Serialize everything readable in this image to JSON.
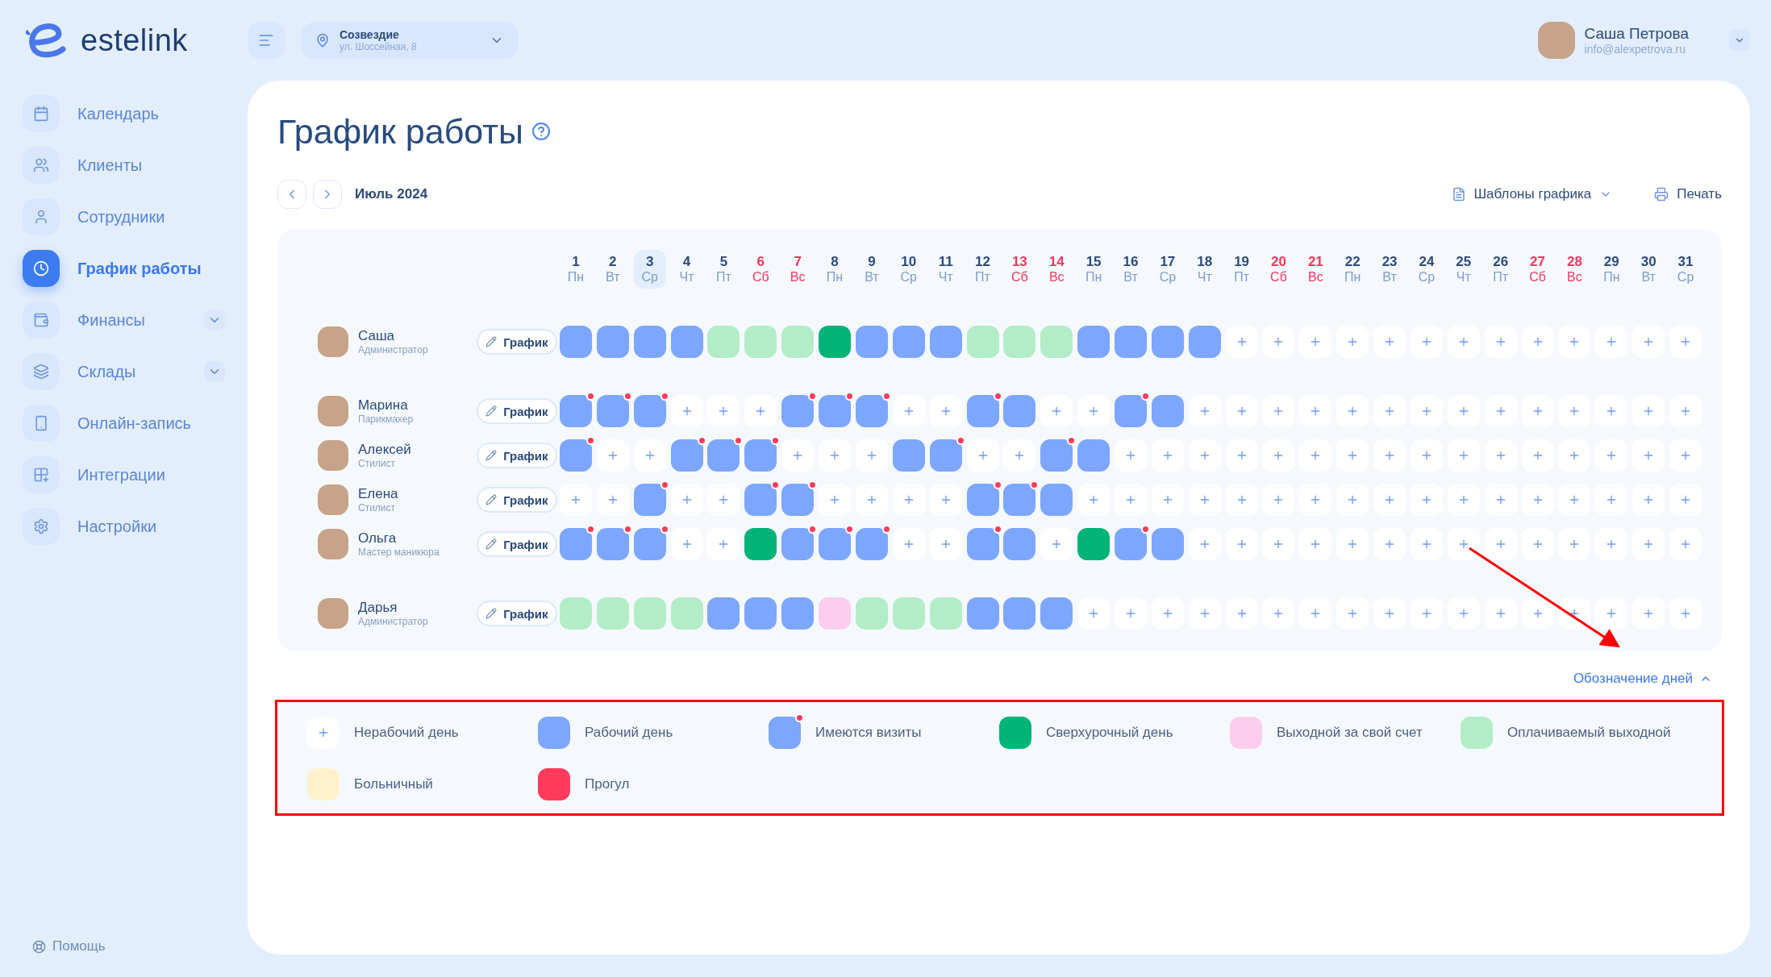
{
  "logo": {
    "text": "estelink"
  },
  "location": {
    "name": "Созвездие",
    "address": "ул. Шоссейная, 8"
  },
  "user": {
    "name": "Саша Петрова",
    "email": "info@alexpetrova.ru"
  },
  "sidebar": {
    "items": [
      {
        "label": "Календарь",
        "selected": false,
        "expandable": false
      },
      {
        "label": "Клиенты",
        "selected": false,
        "expandable": false
      },
      {
        "label": "Сотрудники",
        "selected": false,
        "expandable": false
      },
      {
        "label": "График работы",
        "selected": true,
        "expandable": false
      },
      {
        "label": "Финансы",
        "selected": false,
        "expandable": true
      },
      {
        "label": "Склады",
        "selected": false,
        "expandable": true
      },
      {
        "label": "Онлайн-запись",
        "selected": false,
        "expandable": false
      },
      {
        "label": "Интеграции",
        "selected": false,
        "expandable": false
      },
      {
        "label": "Настройки",
        "selected": false,
        "expandable": false
      }
    ],
    "help": "Помощь"
  },
  "page": {
    "title": "График работы",
    "month": "Июль 2024",
    "templates": "Шаблоны графика",
    "print": "Печать"
  },
  "days": [
    {
      "day": "1",
      "weekday": "Пн",
      "weekend": false,
      "selected": false
    },
    {
      "day": "2",
      "weekday": "Вт",
      "weekend": false,
      "selected": false
    },
    {
      "day": "3",
      "weekday": "Ср",
      "weekend": false,
      "selected": true
    },
    {
      "day": "4",
      "weekday": "Чт",
      "weekend": false,
      "selected": false
    },
    {
      "day": "5",
      "weekday": "Пт",
      "weekend": false,
      "selected": false
    },
    {
      "day": "6",
      "weekday": "Сб",
      "weekend": true,
      "selected": false
    },
    {
      "day": "7",
      "weekday": "Вс",
      "weekend": true,
      "selected": false
    },
    {
      "day": "8",
      "weekday": "Пн",
      "weekend": false,
      "selected": false
    },
    {
      "day": "9",
      "weekday": "Вт",
      "weekend": false,
      "selected": false
    },
    {
      "day": "10",
      "weekday": "Ср",
      "weekend": false,
      "selected": false
    },
    {
      "day": "11",
      "weekday": "Чт",
      "weekend": false,
      "selected": false
    },
    {
      "day": "12",
      "weekday": "Пт",
      "weekend": false,
      "selected": false
    },
    {
      "day": "13",
      "weekday": "Сб",
      "weekend": true,
      "selected": false
    },
    {
      "day": "14",
      "weekday": "Вс",
      "weekend": true,
      "selected": false
    },
    {
      "day": "15",
      "weekday": "Пн",
      "weekend": false,
      "selected": false
    },
    {
      "day": "16",
      "weekday": "Вт",
      "weekend": false,
      "selected": false
    },
    {
      "day": "17",
      "weekday": "Ср",
      "weekend": false,
      "selected": false
    },
    {
      "day": "18",
      "weekday": "Чт",
      "weekend": false,
      "selected": false
    },
    {
      "day": "19",
      "weekday": "Пт",
      "weekend": false,
      "selected": false
    },
    {
      "day": "20",
      "weekday": "Сб",
      "weekend": true,
      "selected": false
    },
    {
      "day": "21",
      "weekday": "Вс",
      "weekend": true,
      "selected": false
    },
    {
      "day": "22",
      "weekday": "Пн",
      "weekend": false,
      "selected": false
    },
    {
      "day": "23",
      "weekday": "Вт",
      "weekend": false,
      "selected": false
    },
    {
      "day": "24",
      "weekday": "Ср",
      "weekend": false,
      "selected": false
    },
    {
      "day": "25",
      "weekday": "Чт",
      "weekend": false,
      "selected": false
    },
    {
      "day": "26",
      "weekday": "Пт",
      "weekend": false,
      "selected": false
    },
    {
      "day": "27",
      "weekday": "Сб",
      "weekend": true,
      "selected": false
    },
    {
      "day": "28",
      "weekday": "Вс",
      "weekend": true,
      "selected": false
    },
    {
      "day": "29",
      "weekday": "Пн",
      "weekend": false,
      "selected": false
    },
    {
      "day": "30",
      "weekday": "Вт",
      "weekend": false,
      "selected": false
    },
    {
      "day": "31",
      "weekday": "Ср",
      "weekend": false,
      "selected": false
    }
  ],
  "groups": [
    {
      "employees": [
        {
          "name": "Саша",
          "role": "Администратор",
          "button": "График",
          "cells": [
            {
              "kind": "work"
            },
            {
              "kind": "work"
            },
            {
              "kind": "work"
            },
            {
              "kind": "work"
            },
            {
              "kind": "paid"
            },
            {
              "kind": "paid"
            },
            {
              "kind": "paid"
            },
            {
              "kind": "overtime"
            },
            {
              "kind": "work"
            },
            {
              "kind": "work"
            },
            {
              "kind": "work"
            },
            {
              "kind": "paid"
            },
            {
              "kind": "paid"
            },
            {
              "kind": "paid"
            },
            {
              "kind": "work"
            },
            {
              "kind": "work"
            },
            {
              "kind": "work"
            },
            {
              "kind": "work"
            },
            {
              "kind": "off"
            },
            {
              "kind": "off"
            },
            {
              "kind": "off"
            },
            {
              "kind": "off"
            },
            {
              "kind": "off"
            },
            {
              "kind": "off"
            },
            {
              "kind": "off"
            },
            {
              "kind": "off"
            },
            {
              "kind": "off"
            },
            {
              "kind": "off"
            },
            {
              "kind": "off"
            },
            {
              "kind": "off"
            },
            {
              "kind": "off"
            }
          ]
        }
      ]
    },
    {
      "employees": [
        {
          "name": "Марина",
          "role": "Парикмахер",
          "button": "График",
          "cells": [
            {
              "kind": "visits"
            },
            {
              "kind": "visits"
            },
            {
              "kind": "visits"
            },
            {
              "kind": "off"
            },
            {
              "kind": "off"
            },
            {
              "kind": "off"
            },
            {
              "kind": "visits"
            },
            {
              "kind": "visits"
            },
            {
              "kind": "visits"
            },
            {
              "kind": "off"
            },
            {
              "kind": "off"
            },
            {
              "kind": "visits"
            },
            {
              "kind": "work"
            },
            {
              "kind": "off"
            },
            {
              "kind": "off"
            },
            {
              "kind": "visits"
            },
            {
              "kind": "work"
            },
            {
              "kind": "off"
            },
            {
              "kind": "off"
            },
            {
              "kind": "off"
            },
            {
              "kind": "off"
            },
            {
              "kind": "off"
            },
            {
              "kind": "off"
            },
            {
              "kind": "off"
            },
            {
              "kind": "off"
            },
            {
              "kind": "off"
            },
            {
              "kind": "off"
            },
            {
              "kind": "off"
            },
            {
              "kind": "off"
            },
            {
              "kind": "off"
            },
            {
              "kind": "off"
            }
          ]
        },
        {
          "name": "Алексей",
          "role": "Стилист",
          "button": "График",
          "cells": [
            {
              "kind": "visits"
            },
            {
              "kind": "off"
            },
            {
              "kind": "off"
            },
            {
              "kind": "visits"
            },
            {
              "kind": "visits"
            },
            {
              "kind": "visits"
            },
            {
              "kind": "off"
            },
            {
              "kind": "off"
            },
            {
              "kind": "off"
            },
            {
              "kind": "work"
            },
            {
              "kind": "visits"
            },
            {
              "kind": "off"
            },
            {
              "kind": "off"
            },
            {
              "kind": "visits"
            },
            {
              "kind": "work"
            },
            {
              "kind": "off"
            },
            {
              "kind": "off"
            },
            {
              "kind": "off"
            },
            {
              "kind": "off"
            },
            {
              "kind": "off"
            },
            {
              "kind": "off"
            },
            {
              "kind": "off"
            },
            {
              "kind": "off"
            },
            {
              "kind": "off"
            },
            {
              "kind": "off"
            },
            {
              "kind": "off"
            },
            {
              "kind": "off"
            },
            {
              "kind": "off"
            },
            {
              "kind": "off"
            },
            {
              "kind": "off"
            },
            {
              "kind": "off"
            }
          ]
        },
        {
          "name": "Елена",
          "role": "Стилист",
          "button": "График",
          "cells": [
            {
              "kind": "off"
            },
            {
              "kind": "off"
            },
            {
              "kind": "visits"
            },
            {
              "kind": "off"
            },
            {
              "kind": "off"
            },
            {
              "kind": "visits"
            },
            {
              "kind": "visits"
            },
            {
              "kind": "off"
            },
            {
              "kind": "off"
            },
            {
              "kind": "off"
            },
            {
              "kind": "off"
            },
            {
              "kind": "visits"
            },
            {
              "kind": "visits"
            },
            {
              "kind": "work"
            },
            {
              "kind": "off"
            },
            {
              "kind": "off"
            },
            {
              "kind": "off"
            },
            {
              "kind": "off"
            },
            {
              "kind": "off"
            },
            {
              "kind": "off"
            },
            {
              "kind": "off"
            },
            {
              "kind": "off"
            },
            {
              "kind": "off"
            },
            {
              "kind": "off"
            },
            {
              "kind": "off"
            },
            {
              "kind": "off"
            },
            {
              "kind": "off"
            },
            {
              "kind": "off"
            },
            {
              "kind": "off"
            },
            {
              "kind": "off"
            },
            {
              "kind": "off"
            }
          ]
        },
        {
          "name": "Ольга",
          "role": "Мастер маникюра",
          "button": "График",
          "cells": [
            {
              "kind": "visits"
            },
            {
              "kind": "visits"
            },
            {
              "kind": "visits"
            },
            {
              "kind": "off"
            },
            {
              "kind": "off"
            },
            {
              "kind": "overtime"
            },
            {
              "kind": "visits"
            },
            {
              "kind": "visits"
            },
            {
              "kind": "visits"
            },
            {
              "kind": "off"
            },
            {
              "kind": "off"
            },
            {
              "kind": "visits"
            },
            {
              "kind": "work"
            },
            {
              "kind": "off"
            },
            {
              "kind": "overtime"
            },
            {
              "kind": "visits"
            },
            {
              "kind": "work"
            },
            {
              "kind": "off"
            },
            {
              "kind": "off"
            },
            {
              "kind": "off"
            },
            {
              "kind": "off"
            },
            {
              "kind": "off"
            },
            {
              "kind": "off"
            },
            {
              "kind": "off"
            },
            {
              "kind": "off"
            },
            {
              "kind": "off"
            },
            {
              "kind": "off"
            },
            {
              "kind": "off"
            },
            {
              "kind": "off"
            },
            {
              "kind": "off"
            },
            {
              "kind": "off"
            }
          ]
        }
      ]
    },
    {
      "employees": [
        {
          "name": "Дарья",
          "role": "Администратор",
          "button": "График",
          "cells": [
            {
              "kind": "paid"
            },
            {
              "kind": "paid"
            },
            {
              "kind": "paid"
            },
            {
              "kind": "paid"
            },
            {
              "kind": "work"
            },
            {
              "kind": "work"
            },
            {
              "kind": "work"
            },
            {
              "kind": "unpaid"
            },
            {
              "kind": "paid"
            },
            {
              "kind": "paid"
            },
            {
              "kind": "paid"
            },
            {
              "kind": "work"
            },
            {
              "kind": "work"
            },
            {
              "kind": "work"
            },
            {
              "kind": "off"
            },
            {
              "kind": "off"
            },
            {
              "kind": "off"
            },
            {
              "kind": "off"
            },
            {
              "kind": "off"
            },
            {
              "kind": "off"
            },
            {
              "kind": "off"
            },
            {
              "kind": "off"
            },
            {
              "kind": "off"
            },
            {
              "kind": "off"
            },
            {
              "kind": "off"
            },
            {
              "kind": "off"
            },
            {
              "kind": "off"
            },
            {
              "kind": "off"
            },
            {
              "kind": "off"
            },
            {
              "kind": "off"
            },
            {
              "kind": "off"
            }
          ]
        }
      ]
    }
  ],
  "legend": {
    "toggle": "Обозначение дней",
    "expanded": true,
    "highlighted": true,
    "items": [
      {
        "kind": "off",
        "label": "Нерабочий день"
      },
      {
        "kind": "work",
        "label": "Рабочий день"
      },
      {
        "kind": "visits",
        "label": "Имеются визиты"
      },
      {
        "kind": "overtime",
        "label": "Сверхурочный день"
      },
      {
        "kind": "unpaid",
        "label": "Выходной за свой счет"
      },
      {
        "kind": "paid",
        "label": "Оплачиваемый выходной"
      },
      {
        "kind": "sick",
        "label": "Больничный"
      },
      {
        "kind": "absent",
        "label": "Прогул"
      }
    ]
  }
}
